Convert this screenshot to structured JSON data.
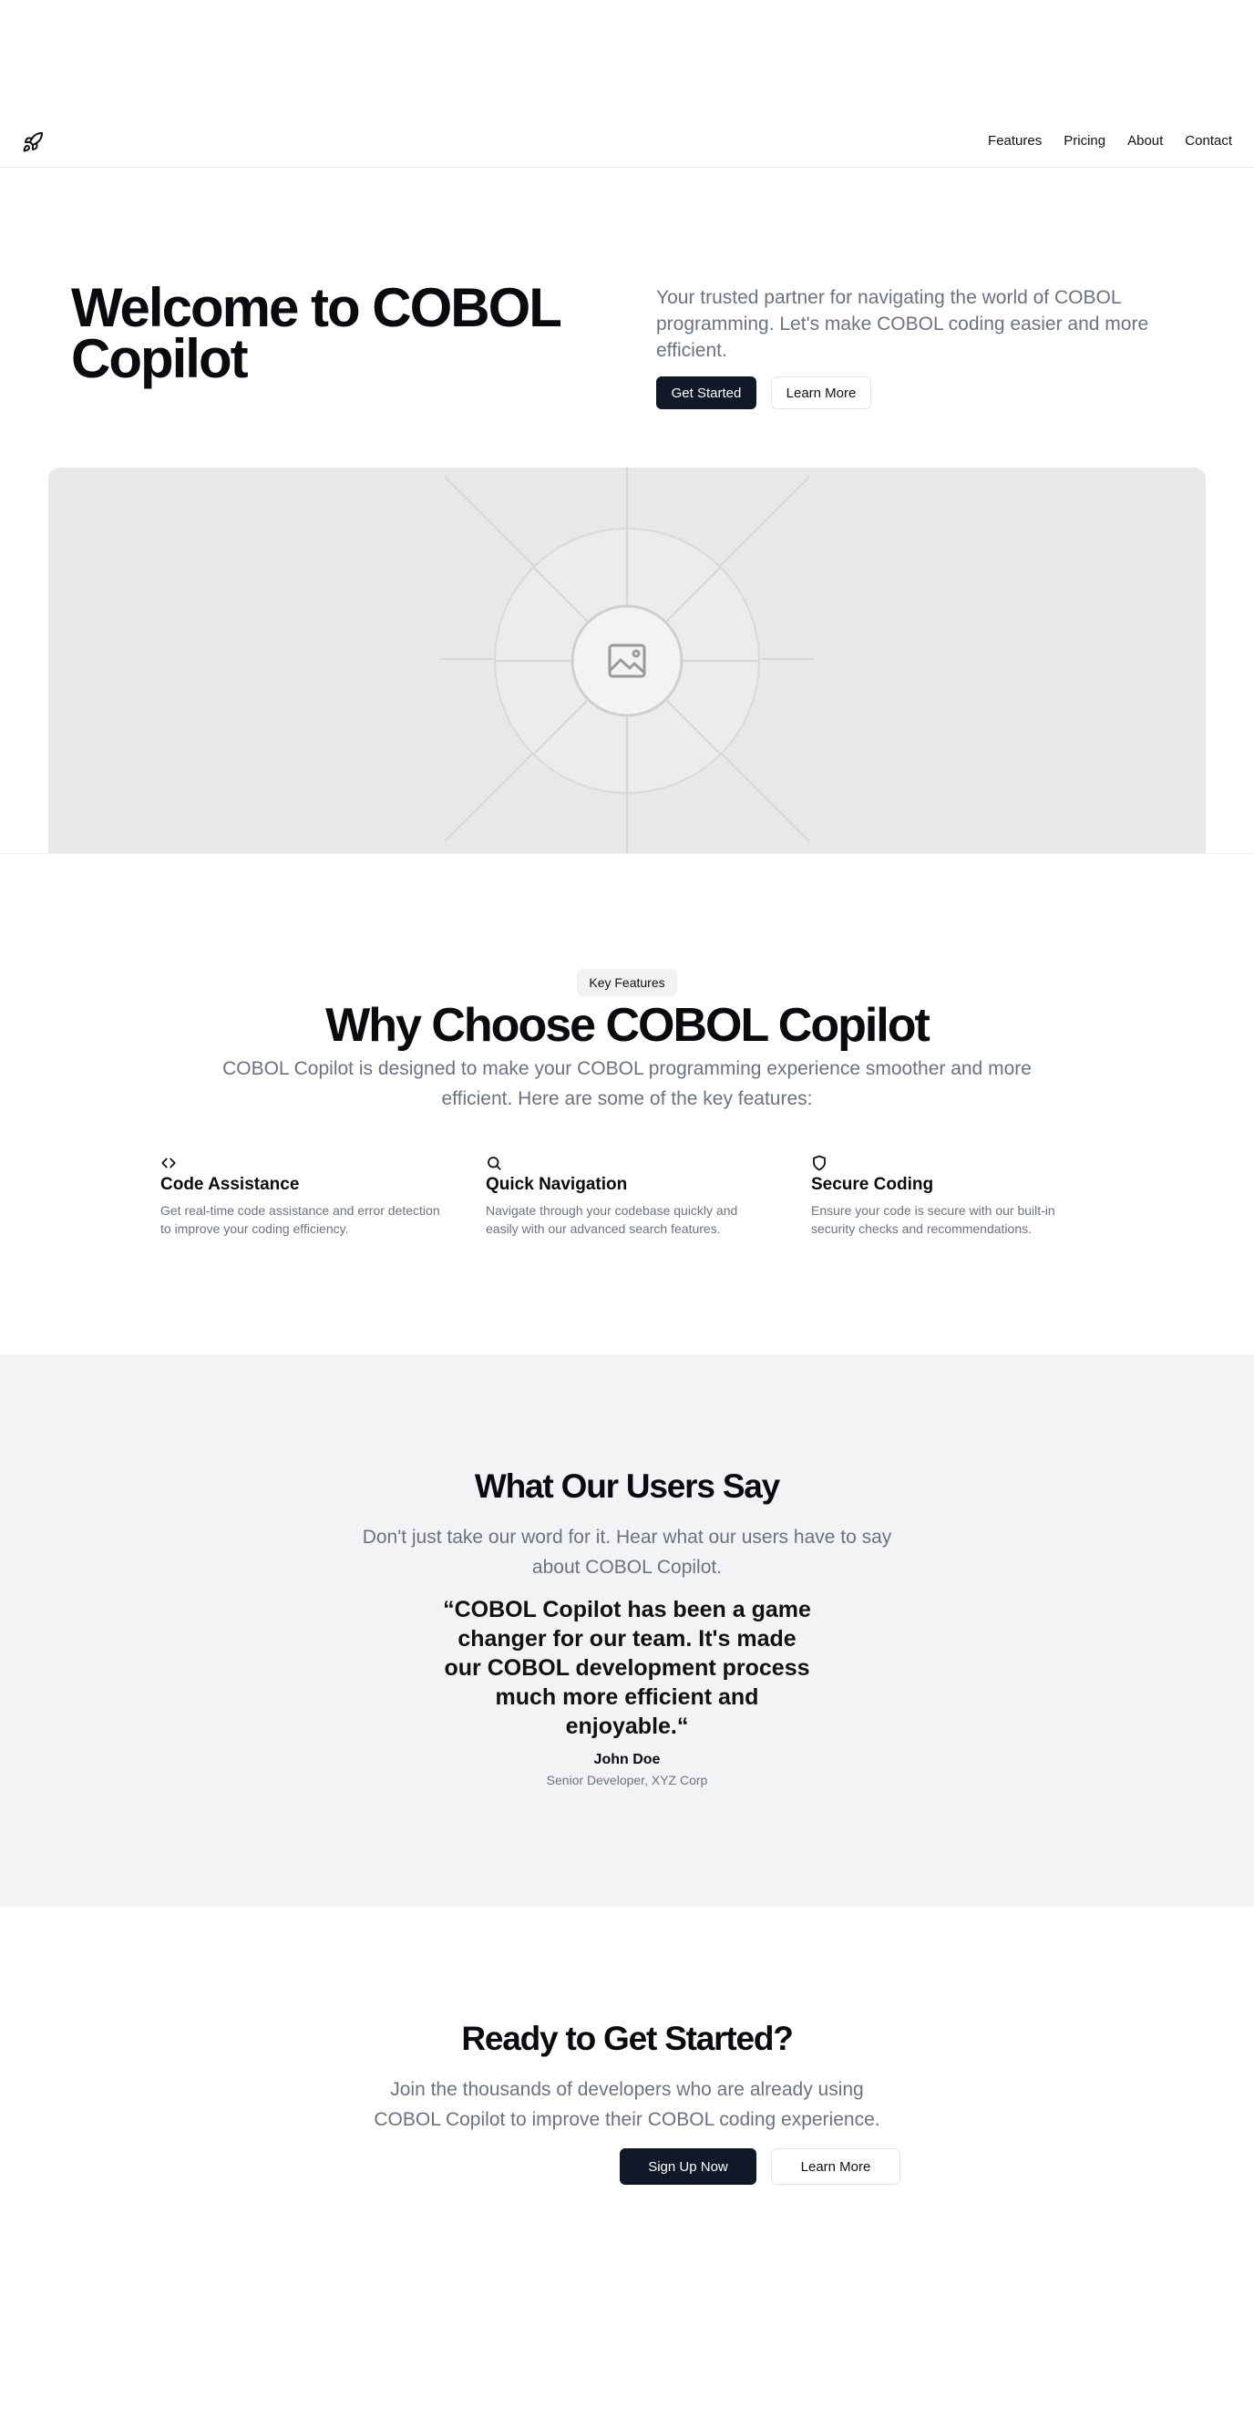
{
  "nav": {
    "logo_icon": "rocket-icon",
    "links": [
      "Features",
      "Pricing",
      "About",
      "Contact"
    ]
  },
  "hero": {
    "title": "Welcome to COBOL Copilot",
    "subtitle": "Your trusted partner for navigating the world of COBOL programming. Let's make COBOL coding easier and more efficient.",
    "primary_button": "Get Started",
    "secondary_button": "Learn More",
    "image_icon": "image-placeholder-icon"
  },
  "features": {
    "badge": "Key Features",
    "title": "Why Choose COBOL Copilot",
    "subtitle": "COBOL Copilot is designed to make your COBOL programming experience smoother and more efficient. Here are some of the key features:",
    "items": [
      {
        "icon": "code-icon",
        "title": "Code Assistance",
        "description": "Get real-time code assistance and error detection to improve your coding efficiency."
      },
      {
        "icon": "search-icon",
        "title": "Quick Navigation",
        "description": "Navigate through your codebase quickly and easily with our advanced search features."
      },
      {
        "icon": "shield-icon",
        "title": "Secure Coding",
        "description": "Ensure your code is secure with our built-in security checks and recommendations."
      }
    ]
  },
  "testimonials": {
    "title": "What Our Users Say",
    "subtitle": "Don't just take our word for it. Hear what our users have to say about COBOL Copilot.",
    "quote": "“COBOL Copilot has been a game changer for our team. It's made our COBOL development process much more efficient and enjoyable.“",
    "author_name": "John Doe",
    "author_role": "Senior Developer, XYZ Corp"
  },
  "cta": {
    "title": "Ready to Get Started?",
    "subtitle": "Join the thousands of developers who are already using COBOL Copilot to improve their COBOL coding experience.",
    "primary_button": "Sign Up Now",
    "secondary_button": "Learn More"
  },
  "colors": {
    "primary_button_bg": "#111827",
    "muted_text": "#6b7280",
    "testimonials_bg": "#f2f3f5",
    "placeholder_bg": "#e8e8e8"
  }
}
